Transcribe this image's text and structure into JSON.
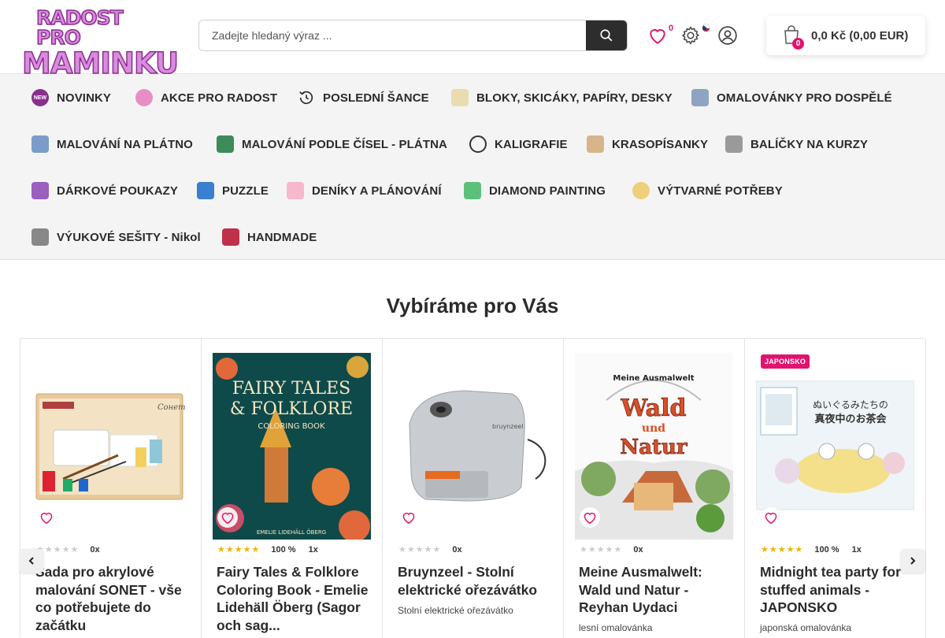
{
  "header": {
    "logo_line1": "RADOST PRO",
    "logo_line2": "MAMINKU",
    "search_placeholder": "Zadejte hledaný výraz ...",
    "favorites_count": "0",
    "cart_count": "0",
    "cart_total": "0,0 Kč (0,00 EUR)",
    "accent_color": "#e2136e"
  },
  "nav": {
    "items": [
      {
        "label": "NOVINKY",
        "icon": "new-badge-icon",
        "color": "#8a2f8e"
      },
      {
        "label": "AKCE PRO RADOST",
        "icon": "smiley-icon",
        "color": "#e78fc3"
      },
      {
        "label": "POSLEDNÍ ŠANCE",
        "icon": "history-clock-icon",
        "color": "#2b2b2b"
      },
      {
        "label": "BLOKY, SKICÁKY, PAPÍRY, DESKY",
        "icon": "sketchbook-icon",
        "color": "#d8c99a"
      },
      {
        "label": "OMALOVÁNKY PRO DOSPĚLÉ",
        "icon": "coloring-book-icon",
        "color": "#6d86a8"
      },
      {
        "label": "MALOVÁNÍ NA PLÁTNO",
        "icon": "canvas-icon",
        "color": "#5a7fb0"
      },
      {
        "label": "MALOVÁNÍ PODLE ČÍSEL - PLÁTNA",
        "icon": "paint-by-numbers-icon",
        "color": "#3d8a5a"
      },
      {
        "label": "KALIGRAFIE",
        "icon": "calligraphy-icon",
        "color": "#333333"
      },
      {
        "label": "KRASOPÍSANKY",
        "icon": "handwriting-icon",
        "color": "#c7a070"
      },
      {
        "label": "BALÍČKY NA KURZY",
        "icon": "course-pack-icon",
        "color": "#777777"
      },
      {
        "label": "DÁRKOVÉ POUKAZY",
        "icon": "gift-voucher-icon",
        "color": "#9b5fc0"
      },
      {
        "label": "PUZZLE",
        "icon": "puzzle-icon",
        "color": "#3a7fd0"
      },
      {
        "label": "DENÍKY A PLÁNOVÁNÍ",
        "icon": "planner-icon",
        "color": "#f0a0b8"
      },
      {
        "label": "DIAMOND PAINTING",
        "icon": "diamond-icon",
        "color": "#5cc07a"
      },
      {
        "label": "VÝTVARNÉ POTŘEBY",
        "icon": "palette-icon",
        "color": "#e0b050"
      },
      {
        "label": "VÝUKOVÉ SEŠITY - Nikol",
        "icon": "workbook-icon",
        "color": "#555555"
      },
      {
        "label": "HANDMADE",
        "icon": "thread-spool-icon",
        "color": "#c0304a"
      }
    ]
  },
  "section": {
    "title": "Vybíráme pro Vás"
  },
  "products": [
    {
      "name": "Sada pro akrylové malování SONET - vše co potřebujete do začátku",
      "desc": "",
      "rating": 0,
      "pct": "",
      "count": "0x",
      "badge": ""
    },
    {
      "name": "Fairy Tales & Folklore Coloring Book - Emelie Lidehäll Öberg (Sagor och sag...",
      "desc": "",
      "rating": 5,
      "pct": "100 %",
      "count": "1x",
      "badge": ""
    },
    {
      "name": "Bruynzeel - Stolní elektrické ořezávátko",
      "desc": "Stolní elektrické ořezávátko",
      "rating": 0,
      "pct": "",
      "count": "0x",
      "badge": ""
    },
    {
      "name": "Meine Ausmalwelt: Wald und Natur - Reyhan Uydaci",
      "desc": "lesní omalovánka",
      "rating": 0,
      "pct": "",
      "count": "0x",
      "badge": ""
    },
    {
      "name": "Midnight tea party for stuffed animals - JAPONSKO",
      "desc": "japonská omalovánka",
      "rating": 5,
      "pct": "100 %",
      "count": "1x",
      "badge": "JAPONSKO"
    }
  ],
  "cover_text": {
    "fairy": {
      "line1": "FAIRY TALES",
      "line2": "& FOLKLORE",
      "line3": "COLORING BOOK",
      "author": "EMELIE LIDEHÄLL ÖBERG"
    },
    "wald": {
      "title1": "Meine Ausmalwelt",
      "title2": "Wald",
      "title3": "und",
      "title4": "Natur"
    },
    "sonet": {
      "brand": "Сонет"
    },
    "bruynzeel": {
      "brand": "bruynzeel"
    }
  }
}
